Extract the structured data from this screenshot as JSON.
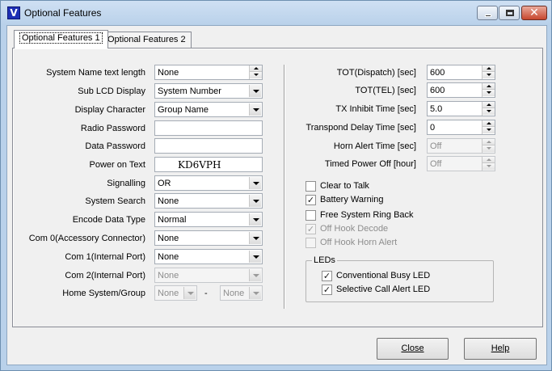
{
  "window": {
    "title": "Optional Features",
    "icon_letter": "V"
  },
  "tabs": [
    {
      "label": "Optional Features 1"
    },
    {
      "label": "Optional Features 2"
    }
  ],
  "left_fields": [
    {
      "label": "System Name text length",
      "value": "None",
      "kind": "spin"
    },
    {
      "label": "Sub LCD Display",
      "value": "System Number",
      "kind": "dropdown"
    },
    {
      "label": "Display Character",
      "value": "Group Name",
      "kind": "dropdown"
    },
    {
      "label": "Radio Password",
      "value": "",
      "kind": "text"
    },
    {
      "label": "Data Password",
      "value": "",
      "kind": "text"
    },
    {
      "label": "Power on Text",
      "value": "KD6VPH",
      "kind": "text"
    },
    {
      "label": "Signalling",
      "value": "OR",
      "kind": "dropdown"
    },
    {
      "label": "System Search",
      "value": "None",
      "kind": "dropdown"
    },
    {
      "label": "Encode Data Type",
      "value": "Normal",
      "kind": "dropdown"
    },
    {
      "label": "Com 0(Accessory Connector)",
      "value": "None",
      "kind": "dropdown"
    },
    {
      "label": "Com 1(Internal Port)",
      "value": "None",
      "kind": "dropdown"
    },
    {
      "label": "Com 2(Internal Port)",
      "value": "None",
      "kind": "dropdown",
      "disabled": true
    }
  ],
  "home_system_group": {
    "label": "Home System/Group",
    "system": "None",
    "separator": "-",
    "group": "None"
  },
  "right_fields": [
    {
      "label": "TOT(Dispatch) [sec]",
      "value": "600"
    },
    {
      "label": "TOT(TEL) [sec]",
      "value": "600"
    },
    {
      "label": "TX Inhibit Time [sec]",
      "value": "5.0"
    },
    {
      "label": "Transpond Delay Time [sec]",
      "value": "0"
    },
    {
      "label": "Horn Alert Time [sec]",
      "value": "Off",
      "disabled": true
    },
    {
      "label": "Timed Power Off [hour]",
      "value": "Off",
      "disabled": true
    }
  ],
  "checkboxes": [
    {
      "label": "Clear to Talk",
      "checked": false,
      "disabled": false
    },
    {
      "label": "Battery Warning",
      "checked": true,
      "disabled": false
    },
    {
      "label": "Free System Ring Back",
      "checked": false,
      "disabled": false
    },
    {
      "label": "Off Hook Decode",
      "checked": true,
      "disabled": true
    },
    {
      "label": "Off Hook Horn Alert",
      "checked": false,
      "disabled": true
    }
  ],
  "leds": {
    "title": "LEDs",
    "items": [
      {
        "label": "Conventional Busy LED",
        "checked": true
      },
      {
        "label": "Selective Call Alert LED",
        "checked": true
      }
    ]
  },
  "buttons": {
    "close": "Close",
    "help": "Help"
  },
  "check_glyph": "✓",
  "close_glyph": "✕"
}
